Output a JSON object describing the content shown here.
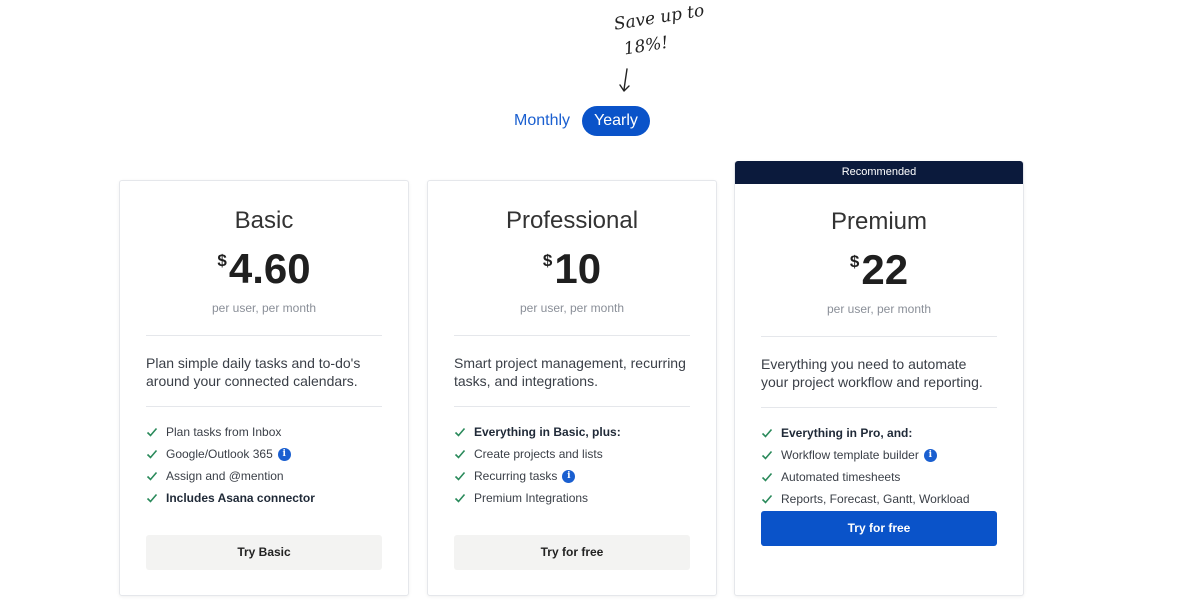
{
  "save_note": {
    "line1": "Save up to",
    "line2": "18%!"
  },
  "billing_toggle": {
    "monthly_label": "Monthly",
    "yearly_label": "Yearly",
    "selected": "Yearly"
  },
  "colors": {
    "accent": "#0a53c9",
    "ribbon": "#0b1a3c",
    "check": "#2a8a5b"
  },
  "plans": [
    {
      "name": "Basic",
      "currency": "$",
      "price": "4.60",
      "per": "per user, per month",
      "description": "Plan simple daily tasks and to-do's around your connected calendars.",
      "features": [
        {
          "text": "Plan tasks from Inbox",
          "bold": false,
          "info": false
        },
        {
          "text": "Google/Outlook 365",
          "bold": false,
          "info": true
        },
        {
          "text": "Assign and @mention",
          "bold": false,
          "info": false
        },
        {
          "text": "Includes Asana connector",
          "bold": true,
          "info": false
        }
      ],
      "cta": "Try Basic"
    },
    {
      "name": "Professional",
      "currency": "$",
      "price": "10",
      "per": "per user, per month",
      "description": "Smart project management, recurring tasks, and integrations.",
      "features": [
        {
          "text": "Everything in Basic, plus:",
          "bold": true,
          "info": false
        },
        {
          "text": "Create projects and lists",
          "bold": false,
          "info": false
        },
        {
          "text": "Recurring tasks",
          "bold": false,
          "info": true
        },
        {
          "text": "Premium Integrations",
          "bold": false,
          "info": false
        }
      ],
      "cta": "Try for free"
    },
    {
      "ribbon": "Recommended",
      "name": "Premium",
      "currency": "$",
      "price": "22",
      "per": "per user, per month",
      "description": "Everything you need to automate your project workflow and reporting.",
      "features": [
        {
          "text": "Everything in Pro, and:",
          "bold": true,
          "info": false
        },
        {
          "text": "Workflow template builder",
          "bold": false,
          "info": true
        },
        {
          "text": "Automated timesheets",
          "bold": false,
          "info": false
        },
        {
          "text": "Reports, Forecast, Gantt, Workload",
          "bold": false,
          "info": false
        }
      ],
      "cta": "Try for free"
    }
  ]
}
